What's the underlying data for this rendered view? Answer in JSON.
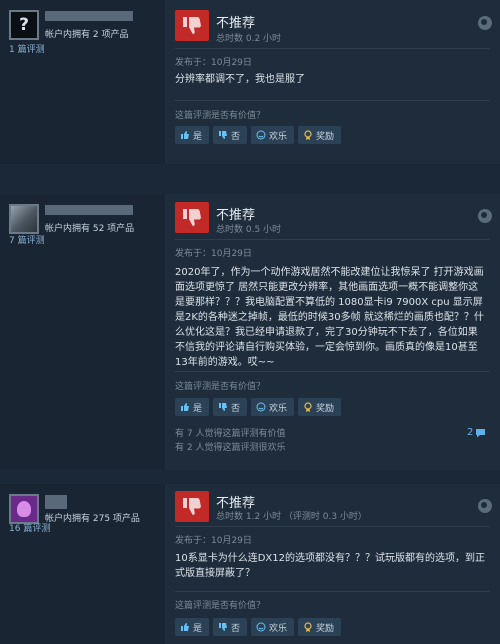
{
  "reviews": [
    {
      "owned": "帐户内拥有 2 项产品",
      "review_count": "1 篇评测",
      "recommendation": "不推荐",
      "hours": "总时数 0.2 小时",
      "posted": "发布于：10月29日",
      "text": "分辨率都调不了，我也是服了",
      "helpful_question": "这篇评测是否有价值？",
      "buttons": {
        "yes": "是",
        "no": "否",
        "funny": "欢乐",
        "award": "奖励"
      }
    },
    {
      "owned": "帐户内拥有 52 项产品",
      "review_count": "7 篇评测",
      "recommendation": "不推荐",
      "hours": "总时数 0.5 小时",
      "posted": "发布于：10月29日",
      "text": "2020年了，作为一个动作游戏居然不能改建位让我惊呆了 打开游戏画面选项更惊了 居然只能更改分辨率，其他画面选项一概不能调整你这是要那样？？？我电脑配置不算低的 1080显卡i9 7900X cpu 显示屏是2K的各种迷之掉帧，最低的时候30多帧 就这稀烂的画质也配？？什么优化这是？我已经申请退款了，完了30分钟玩不下去了，各位如果不信我的评论请自行购买体验，一定会惊到你。画质真的像是10甚至13年前的游戏。哎~~",
      "helpful_question": "这篇评测是否有价值？",
      "buttons": {
        "yes": "是",
        "no": "否",
        "funny": "欢乐",
        "award": "奖励"
      },
      "helpful_count": "有 7 人觉得这篇评测有价值",
      "funny_count": "有 2 人觉得这篇评测很欢乐",
      "comment_count": "2"
    },
    {
      "owned": "帐户内拥有 275 项产品",
      "review_count": "16 篇评测",
      "recommendation": "不推荐",
      "hours": "总时数 1.2 小时 （评测时 0.3 小时）",
      "posted": "发布于：10月29日",
      "text": "10系显卡为什么连DX12的选项都没有？？？试玩版都有的选项，到正式版直接屏蔽了？",
      "helpful_question": "这篇评测是否有价值？",
      "buttons": {
        "yes": "是",
        "no": "否",
        "funny": "欢乐",
        "award": "奖励"
      }
    }
  ],
  "colors": {
    "thumbs_down": "#c22a28",
    "link": "#8ab4d6",
    "button_bg": "#2b4155"
  }
}
